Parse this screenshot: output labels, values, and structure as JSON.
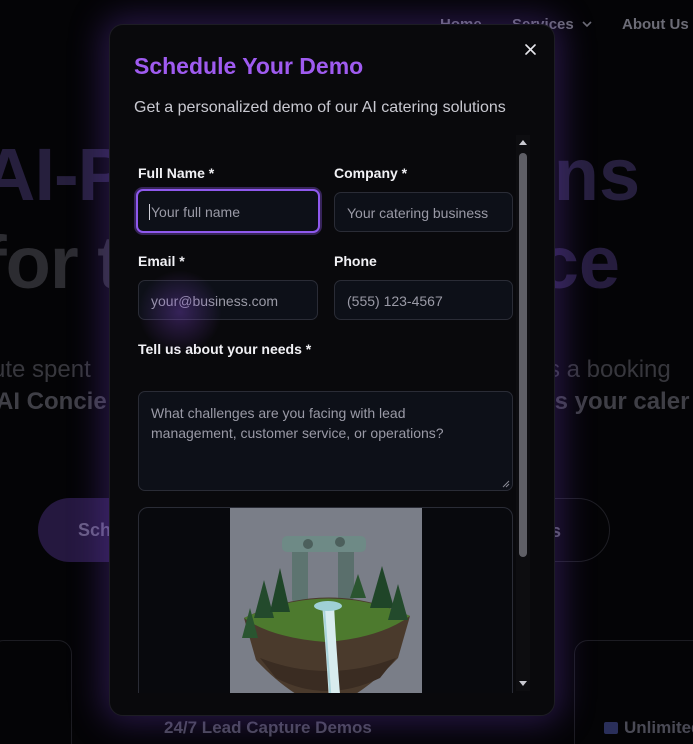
{
  "nav": {
    "home": "Home",
    "services": "Services",
    "about": "About Us"
  },
  "hero": {
    "line1_left": "AI-P",
    "line1_right": "ions",
    "line2_left": "for t",
    "line2_right": "vice",
    "sub1_left": "ute spent",
    "sub1_right": "s a booking",
    "sub2_left": "AI Concie",
    "sub2_right": "ls your caler"
  },
  "ctas": {
    "left_label": "Sch",
    "right_label": "es"
  },
  "cards": {
    "mid_title": "24/7 Lead Capture Demos",
    "right_title": "Unlimited"
  },
  "modal": {
    "title": "Schedule Your Demo",
    "subtitle": "Get a personalized demo of our AI catering solutions",
    "title_color": "#9f5bf0",
    "focus_color": "#8f59ee",
    "fields": {
      "full_name": {
        "label": "Full Name *",
        "placeholder": "Your full name"
      },
      "company": {
        "label": "Company *",
        "placeholder": "Your catering business"
      },
      "email": {
        "label": "Email *",
        "placeholder": "your@business.com"
      },
      "phone": {
        "label": "Phone",
        "placeholder": "(555) 123-4567"
      },
      "needs": {
        "label": "Tell us about your needs *",
        "placeholder_line1": "What challenges are you facing with lead",
        "placeholder_line2": "management, customer service, or operations?"
      }
    },
    "image": {
      "icon": "floating-island-waterfall-illustration"
    },
    "close_icon": "close-icon"
  }
}
